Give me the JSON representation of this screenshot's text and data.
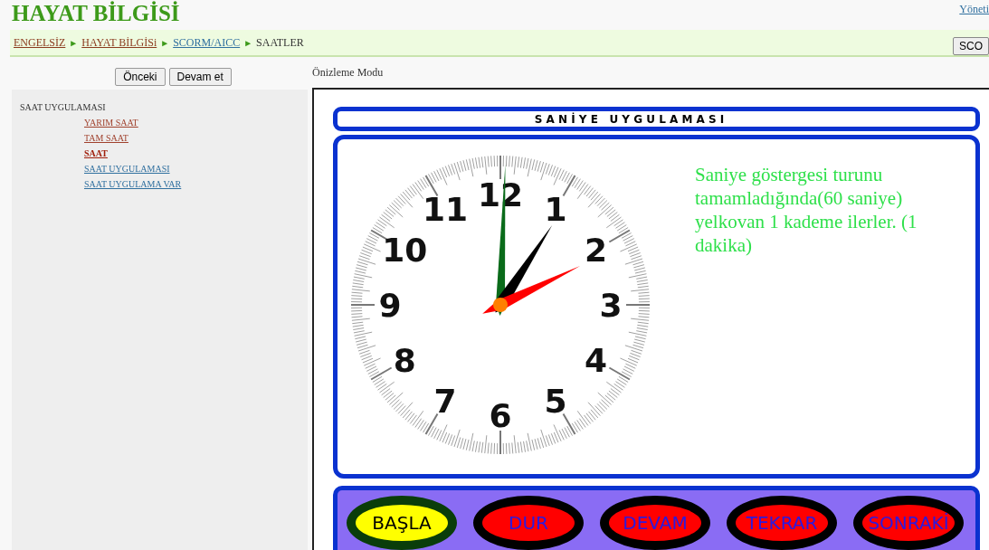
{
  "header": {
    "title": "HAYAT BİLGİSİ",
    "admin_link": "Yöneti"
  },
  "breadcrumb": {
    "items": [
      {
        "label": "ENGELSİZ",
        "kind": "link",
        "color": "#8b3a1e"
      },
      {
        "label": "HAYAT BİLGİSi",
        "kind": "link",
        "color": "#8b3a1e"
      },
      {
        "label": "SCORM/AICC",
        "kind": "link",
        "color": "#2f6f9f"
      },
      {
        "label": "SAATLER",
        "kind": "current",
        "color": "#333333"
      }
    ],
    "separator": "►",
    "right_button": "SCO"
  },
  "nav_buttons": [
    "Önceki",
    "Devam et"
  ],
  "preview_label": "Önizleme Modu",
  "toc": {
    "heading": "SAAT UYGULAMASI",
    "items": [
      {
        "label": "YARIM SAAT",
        "color": "#a0412d",
        "selected": false
      },
      {
        "label": "TAM SAAT",
        "color": "#a0412d",
        "selected": false
      },
      {
        "label": "SAAT",
        "color": "#a0200d",
        "selected": true
      },
      {
        "label": "SAAT UYGULAMASI",
        "color": "#2f6f9f",
        "selected": false
      },
      {
        "label": "SAAT UYGULAMA VAR",
        "color": "#2f6f9f",
        "selected": false
      }
    ]
  },
  "activity": {
    "title": "S A N İ Y E   U Y G U L A M A S I",
    "clock": {
      "numeral_rows": [
        [
          "12"
        ],
        [
          "11",
          "1"
        ],
        [
          "10",
          "2"
        ],
        [
          "9",
          "3"
        ],
        [
          "8",
          "4"
        ],
        [
          "7",
          "5"
        ],
        [
          "6"
        ]
      ]
    },
    "explanation": "Saniye göstergesi turunu tamamladığında(60 saniye) yelkovan 1 kademe ilerler. (1 dakika)",
    "controls": [
      {
        "label": "BAŞLA",
        "selected": true
      },
      {
        "label": "DUR",
        "selected": false
      },
      {
        "label": "DEVAM",
        "selected": false
      },
      {
        "label": "TEKRAR",
        "selected": false
      },
      {
        "label": "SONRAKİ",
        "selected": false
      }
    ]
  }
}
